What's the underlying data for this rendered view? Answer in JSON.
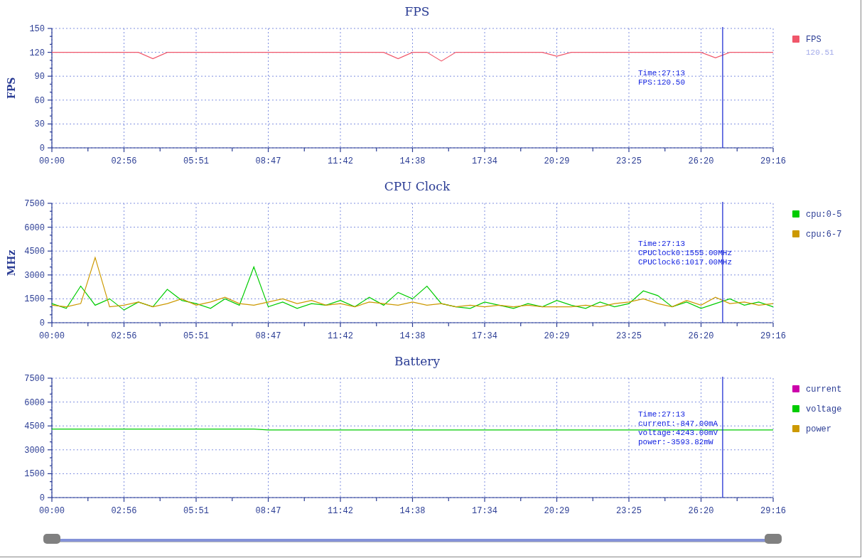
{
  "charts": [
    {
      "chart_data": {
        "type": "line",
        "title": "FPS",
        "ylabel": "FPS",
        "xlim": [
          0,
          1756
        ],
        "ylim": [
          0,
          150
        ],
        "yticks": [
          0,
          30,
          60,
          90,
          120,
          150
        ],
        "xticks": [
          {
            "value": 0,
            "label": "00:00"
          },
          {
            "value": 175.6,
            "label": "02:56"
          },
          {
            "value": 351.2,
            "label": "05:51"
          },
          {
            "value": 526.8,
            "label": "08:47"
          },
          {
            "value": 702.4,
            "label": "11:42"
          },
          {
            "value": 878,
            "label": "14:38"
          },
          {
            "value": 1053.6,
            "label": "17:34"
          },
          {
            "value": 1229.2,
            "label": "20:29"
          },
          {
            "value": 1404.8,
            "label": "23:25"
          },
          {
            "value": 1580.4,
            "label": "26:20"
          },
          {
            "value": 1756,
            "label": "29:16"
          }
        ],
        "x": [
          0,
          35.1,
          70.2,
          105.4,
          140.5,
          175.6,
          210.7,
          245.8,
          281,
          316.1,
          351.2,
          386.3,
          421.4,
          456.6,
          491.7,
          526.8,
          561.9,
          597,
          632.2,
          667.3,
          702.4,
          737.5,
          772.6,
          807.8,
          842.9,
          878,
          913.1,
          948.2,
          983.4,
          1018.5,
          1053.6,
          1088.7,
          1123.8,
          1159,
          1194.1,
          1229.2,
          1264.3,
          1299.4,
          1334.6,
          1369.7,
          1404.8,
          1439.9,
          1475,
          1510.2,
          1545.3,
          1580.4,
          1615.5,
          1650.6,
          1685.8,
          1720.9,
          1756
        ],
        "series": [
          {
            "name": "FPS",
            "color": "#f0566a",
            "values": [
              120,
              120,
              120,
              120,
              120,
              120,
              120,
              112,
              120,
              120,
              120,
              120,
              120,
              120,
              120,
              120,
              120,
              120,
              120,
              120,
              120,
              120,
              120,
              120,
              112,
              120,
              120,
              109,
              120,
              120,
              120,
              120,
              120,
              120,
              120,
              115,
              120,
              120,
              120,
              120,
              120,
              120,
              120,
              120,
              120,
              120,
              113,
              120,
              120,
              120,
              120
            ]
          }
        ],
        "grid": true,
        "legend": "right",
        "ref_lines": [
          {
            "axis": "x",
            "value": 1633
          }
        ]
      },
      "legend_readings": [
        "120.51"
      ],
      "tooltip": [
        "Time:27:13",
        "FPS:120.50"
      ]
    },
    {
      "chart_data": {
        "type": "line",
        "title": "CPU Clock",
        "ylabel": "MHz",
        "xlim": [
          0,
          1756
        ],
        "ylim": [
          0,
          7500
        ],
        "yticks": [
          0,
          1500,
          3000,
          4500,
          6000,
          7500
        ],
        "xticks": [
          {
            "value": 0,
            "label": "00:00"
          },
          {
            "value": 175.6,
            "label": "02:56"
          },
          {
            "value": 351.2,
            "label": "05:51"
          },
          {
            "value": 526.8,
            "label": "08:47"
          },
          {
            "value": 702.4,
            "label": "11:42"
          },
          {
            "value": 878,
            "label": "14:38"
          },
          {
            "value": 1053.6,
            "label": "17:34"
          },
          {
            "value": 1229.2,
            "label": "20:29"
          },
          {
            "value": 1404.8,
            "label": "23:25"
          },
          {
            "value": 1580.4,
            "label": "26:20"
          },
          {
            "value": 1756,
            "label": "29:16"
          }
        ],
        "x": [
          0,
          35.1,
          70.2,
          105.4,
          140.5,
          175.6,
          210.7,
          245.8,
          281,
          316.1,
          351.2,
          386.3,
          421.4,
          456.6,
          491.7,
          526.8,
          561.9,
          597,
          632.2,
          667.3,
          702.4,
          737.5,
          772.6,
          807.8,
          842.9,
          878,
          913.1,
          948.2,
          983.4,
          1018.5,
          1053.6,
          1088.7,
          1123.8,
          1159,
          1194.1,
          1229.2,
          1264.3,
          1299.4,
          1334.6,
          1369.7,
          1404.8,
          1439.9,
          1475,
          1510.2,
          1545.3,
          1580.4,
          1615.5,
          1650.6,
          1685.8,
          1720.9,
          1756
        ],
        "series": [
          {
            "name": "cpu:0-5",
            "color": "#00cc00",
            "values": [
              1200,
              900,
              2300,
              1100,
              1500,
              800,
              1300,
              1000,
              2100,
              1400,
              1200,
              900,
              1500,
              1100,
              3500,
              1000,
              1300,
              900,
              1200,
              1100,
              1400,
              1000,
              1600,
              1100,
              1900,
              1500,
              2300,
              1200,
              1000,
              900,
              1300,
              1100,
              900,
              1200,
              1000,
              1400,
              1100,
              900,
              1300,
              1000,
              1200,
              2000,
              1700,
              1000,
              1300,
              900,
              1200,
              1500,
              1100,
              1300,
              1000
            ]
          },
          {
            "name": "cpu:6-7",
            "color": "#cc9900",
            "values": [
              1100,
              1000,
              1200,
              4100,
              1000,
              1100,
              1300,
              1000,
              1200,
              1500,
              1100,
              1300,
              1600,
              1200,
              1100,
              1300,
              1500,
              1200,
              1400,
              1100,
              1200,
              1000,
              1300,
              1200,
              1100,
              1300,
              1100,
              1200,
              1000,
              1100,
              1000,
              1100,
              1000,
              1100,
              1000,
              1000,
              1000,
              1100,
              1000,
              1200,
              1300,
              1500,
              1200,
              1000,
              1400,
              1100,
              1600,
              1200,
              1300,
              1100,
              1200
            ]
          }
        ],
        "grid": true,
        "legend": "right",
        "ref_lines": [
          {
            "axis": "x",
            "value": 1633
          }
        ]
      },
      "tooltip": [
        "Time:27:13",
        "CPUClock0:1555.00MHz",
        "CPUClock6:1017.00MHz"
      ]
    },
    {
      "chart_data": {
        "type": "line",
        "title": "Battery",
        "xlim": [
          0,
          1756
        ],
        "ylim": [
          0,
          7500
        ],
        "yticks": [
          0,
          1500,
          3000,
          4500,
          6000,
          7500
        ],
        "xticks": [
          {
            "value": 0,
            "label": "00:00"
          },
          {
            "value": 175.6,
            "label": "02:56"
          },
          {
            "value": 351.2,
            "label": "05:51"
          },
          {
            "value": 526.8,
            "label": "08:47"
          },
          {
            "value": 702.4,
            "label": "11:42"
          },
          {
            "value": 878,
            "label": "14:38"
          },
          {
            "value": 1053.6,
            "label": "17:34"
          },
          {
            "value": 1229.2,
            "label": "20:29"
          },
          {
            "value": 1404.8,
            "label": "23:25"
          },
          {
            "value": 1580.4,
            "label": "26:20"
          },
          {
            "value": 1756,
            "label": "29:16"
          }
        ],
        "x": [
          0,
          35.1,
          70.2,
          105.4,
          140.5,
          175.6,
          210.7,
          245.8,
          281,
          316.1,
          351.2,
          386.3,
          421.4,
          456.6,
          491.7,
          526.8,
          561.9,
          597,
          632.2,
          667.3,
          702.4,
          737.5,
          772.6,
          807.8,
          842.9,
          878,
          913.1,
          948.2,
          983.4,
          1018.5,
          1053.6,
          1088.7,
          1123.8,
          1159,
          1194.1,
          1229.2,
          1264.3,
          1299.4,
          1334.6,
          1369.7,
          1404.8,
          1439.9,
          1475,
          1510.2,
          1545.3,
          1580.4,
          1615.5,
          1650.6,
          1685.8,
          1720.9,
          1756
        ],
        "series": [
          {
            "name": "current",
            "color": "#cc00aa",
            "values": [
              null,
              null,
              null,
              null,
              null,
              null,
              null,
              null,
              null,
              null,
              null,
              null,
              null,
              null,
              null,
              null,
              null,
              null,
              null,
              null,
              null,
              null,
              null,
              null,
              null,
              null,
              null,
              null,
              null,
              null,
              null,
              null,
              null,
              null,
              null,
              null,
              null,
              null,
              null,
              null,
              null,
              null,
              null,
              null,
              null,
              null,
              null,
              null,
              null,
              null,
              null
            ]
          },
          {
            "name": "voltage",
            "color": "#00cc00",
            "values": [
              4300,
              4300,
              4300,
              4300,
              4300,
              4300,
              4300,
              4300,
              4300,
              4300,
              4300,
              4300,
              4300,
              4300,
              4300,
              4250,
              4250,
              4250,
              4250,
              4250,
              4250,
              4250,
              4250,
              4250,
              4250,
              4250,
              4250,
              4250,
              4250,
              4250,
              4250,
              4250,
              4250,
              4250,
              4250,
              4250,
              4250,
              4250,
              4250,
              4250,
              4250,
              4250,
              4250,
              4250,
              4250,
              4250,
              4250,
              4250,
              4250,
              4250,
              4250
            ]
          },
          {
            "name": "power",
            "color": "#cc9900",
            "values": [
              null,
              null,
              null,
              null,
              null,
              null,
              null,
              null,
              null,
              null,
              null,
              null,
              null,
              null,
              null,
              null,
              null,
              null,
              null,
              null,
              null,
              null,
              null,
              null,
              null,
              null,
              null,
              null,
              null,
              null,
              null,
              null,
              null,
              null,
              null,
              null,
              null,
              null,
              null,
              null,
              null,
              null,
              null,
              null,
              null,
              null,
              null,
              null,
              null,
              null,
              null
            ]
          }
        ],
        "grid": true,
        "legend": "right",
        "ref_lines": [
          {
            "axis": "x",
            "value": 1633
          }
        ]
      },
      "tooltip": [
        "Time:27:13",
        "current:-847.00mA",
        "voltage:4243.00mV",
        "power:-3593.82mW"
      ]
    }
  ],
  "zoom_slider": {
    "start": {
      "level": 0
    },
    "end": {
      "level": 1
    }
  }
}
